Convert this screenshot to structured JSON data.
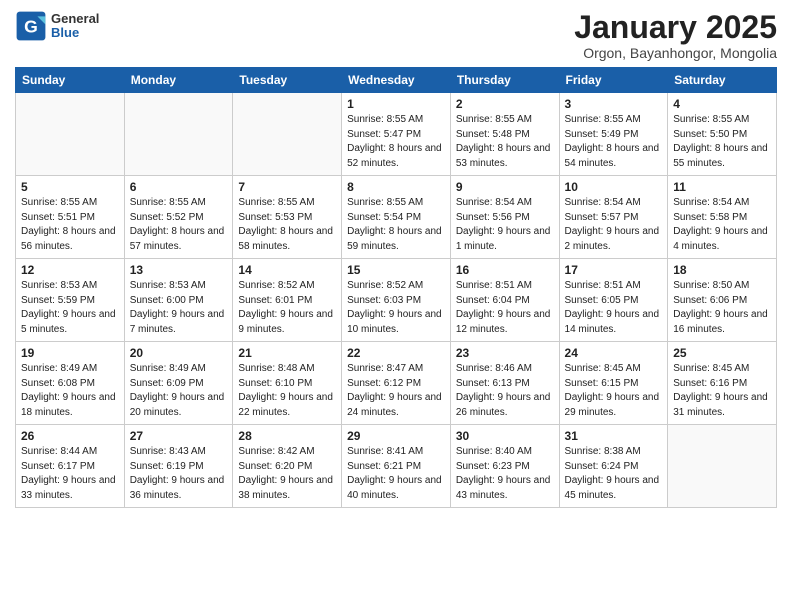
{
  "logo": {
    "general": "General",
    "blue": "Blue"
  },
  "header": {
    "month": "January 2025",
    "location": "Orgon, Bayanhongor, Mongolia"
  },
  "weekdays": [
    "Sunday",
    "Monday",
    "Tuesday",
    "Wednesday",
    "Thursday",
    "Friday",
    "Saturday"
  ],
  "weeks": [
    [
      {
        "day": null
      },
      {
        "day": null
      },
      {
        "day": null
      },
      {
        "day": "1",
        "sunrise": "8:55 AM",
        "sunset": "5:47 PM",
        "daylight": "8 hours and 52 minutes."
      },
      {
        "day": "2",
        "sunrise": "8:55 AM",
        "sunset": "5:48 PM",
        "daylight": "8 hours and 53 minutes."
      },
      {
        "day": "3",
        "sunrise": "8:55 AM",
        "sunset": "5:49 PM",
        "daylight": "8 hours and 54 minutes."
      },
      {
        "day": "4",
        "sunrise": "8:55 AM",
        "sunset": "5:50 PM",
        "daylight": "8 hours and 55 minutes."
      }
    ],
    [
      {
        "day": "5",
        "sunrise": "8:55 AM",
        "sunset": "5:51 PM",
        "daylight": "8 hours and 56 minutes."
      },
      {
        "day": "6",
        "sunrise": "8:55 AM",
        "sunset": "5:52 PM",
        "daylight": "8 hours and 57 minutes."
      },
      {
        "day": "7",
        "sunrise": "8:55 AM",
        "sunset": "5:53 PM",
        "daylight": "8 hours and 58 minutes."
      },
      {
        "day": "8",
        "sunrise": "8:55 AM",
        "sunset": "5:54 PM",
        "daylight": "8 hours and 59 minutes."
      },
      {
        "day": "9",
        "sunrise": "8:54 AM",
        "sunset": "5:56 PM",
        "daylight": "9 hours and 1 minute."
      },
      {
        "day": "10",
        "sunrise": "8:54 AM",
        "sunset": "5:57 PM",
        "daylight": "9 hours and 2 minutes."
      },
      {
        "day": "11",
        "sunrise": "8:54 AM",
        "sunset": "5:58 PM",
        "daylight": "9 hours and 4 minutes."
      }
    ],
    [
      {
        "day": "12",
        "sunrise": "8:53 AM",
        "sunset": "5:59 PM",
        "daylight": "9 hours and 5 minutes."
      },
      {
        "day": "13",
        "sunrise": "8:53 AM",
        "sunset": "6:00 PM",
        "daylight": "9 hours and 7 minutes."
      },
      {
        "day": "14",
        "sunrise": "8:52 AM",
        "sunset": "6:01 PM",
        "daylight": "9 hours and 9 minutes."
      },
      {
        "day": "15",
        "sunrise": "8:52 AM",
        "sunset": "6:03 PM",
        "daylight": "9 hours and 10 minutes."
      },
      {
        "day": "16",
        "sunrise": "8:51 AM",
        "sunset": "6:04 PM",
        "daylight": "9 hours and 12 minutes."
      },
      {
        "day": "17",
        "sunrise": "8:51 AM",
        "sunset": "6:05 PM",
        "daylight": "9 hours and 14 minutes."
      },
      {
        "day": "18",
        "sunrise": "8:50 AM",
        "sunset": "6:06 PM",
        "daylight": "9 hours and 16 minutes."
      }
    ],
    [
      {
        "day": "19",
        "sunrise": "8:49 AM",
        "sunset": "6:08 PM",
        "daylight": "9 hours and 18 minutes."
      },
      {
        "day": "20",
        "sunrise": "8:49 AM",
        "sunset": "6:09 PM",
        "daylight": "9 hours and 20 minutes."
      },
      {
        "day": "21",
        "sunrise": "8:48 AM",
        "sunset": "6:10 PM",
        "daylight": "9 hours and 22 minutes."
      },
      {
        "day": "22",
        "sunrise": "8:47 AM",
        "sunset": "6:12 PM",
        "daylight": "9 hours and 24 minutes."
      },
      {
        "day": "23",
        "sunrise": "8:46 AM",
        "sunset": "6:13 PM",
        "daylight": "9 hours and 26 minutes."
      },
      {
        "day": "24",
        "sunrise": "8:45 AM",
        "sunset": "6:15 PM",
        "daylight": "9 hours and 29 minutes."
      },
      {
        "day": "25",
        "sunrise": "8:45 AM",
        "sunset": "6:16 PM",
        "daylight": "9 hours and 31 minutes."
      }
    ],
    [
      {
        "day": "26",
        "sunrise": "8:44 AM",
        "sunset": "6:17 PM",
        "daylight": "9 hours and 33 minutes."
      },
      {
        "day": "27",
        "sunrise": "8:43 AM",
        "sunset": "6:19 PM",
        "daylight": "9 hours and 36 minutes."
      },
      {
        "day": "28",
        "sunrise": "8:42 AM",
        "sunset": "6:20 PM",
        "daylight": "9 hours and 38 minutes."
      },
      {
        "day": "29",
        "sunrise": "8:41 AM",
        "sunset": "6:21 PM",
        "daylight": "9 hours and 40 minutes."
      },
      {
        "day": "30",
        "sunrise": "8:40 AM",
        "sunset": "6:23 PM",
        "daylight": "9 hours and 43 minutes."
      },
      {
        "day": "31",
        "sunrise": "8:38 AM",
        "sunset": "6:24 PM",
        "daylight": "9 hours and 45 minutes."
      },
      {
        "day": null
      }
    ]
  ],
  "labels": {
    "sunrise": "Sunrise:",
    "sunset": "Sunset:",
    "daylight": "Daylight hours"
  }
}
